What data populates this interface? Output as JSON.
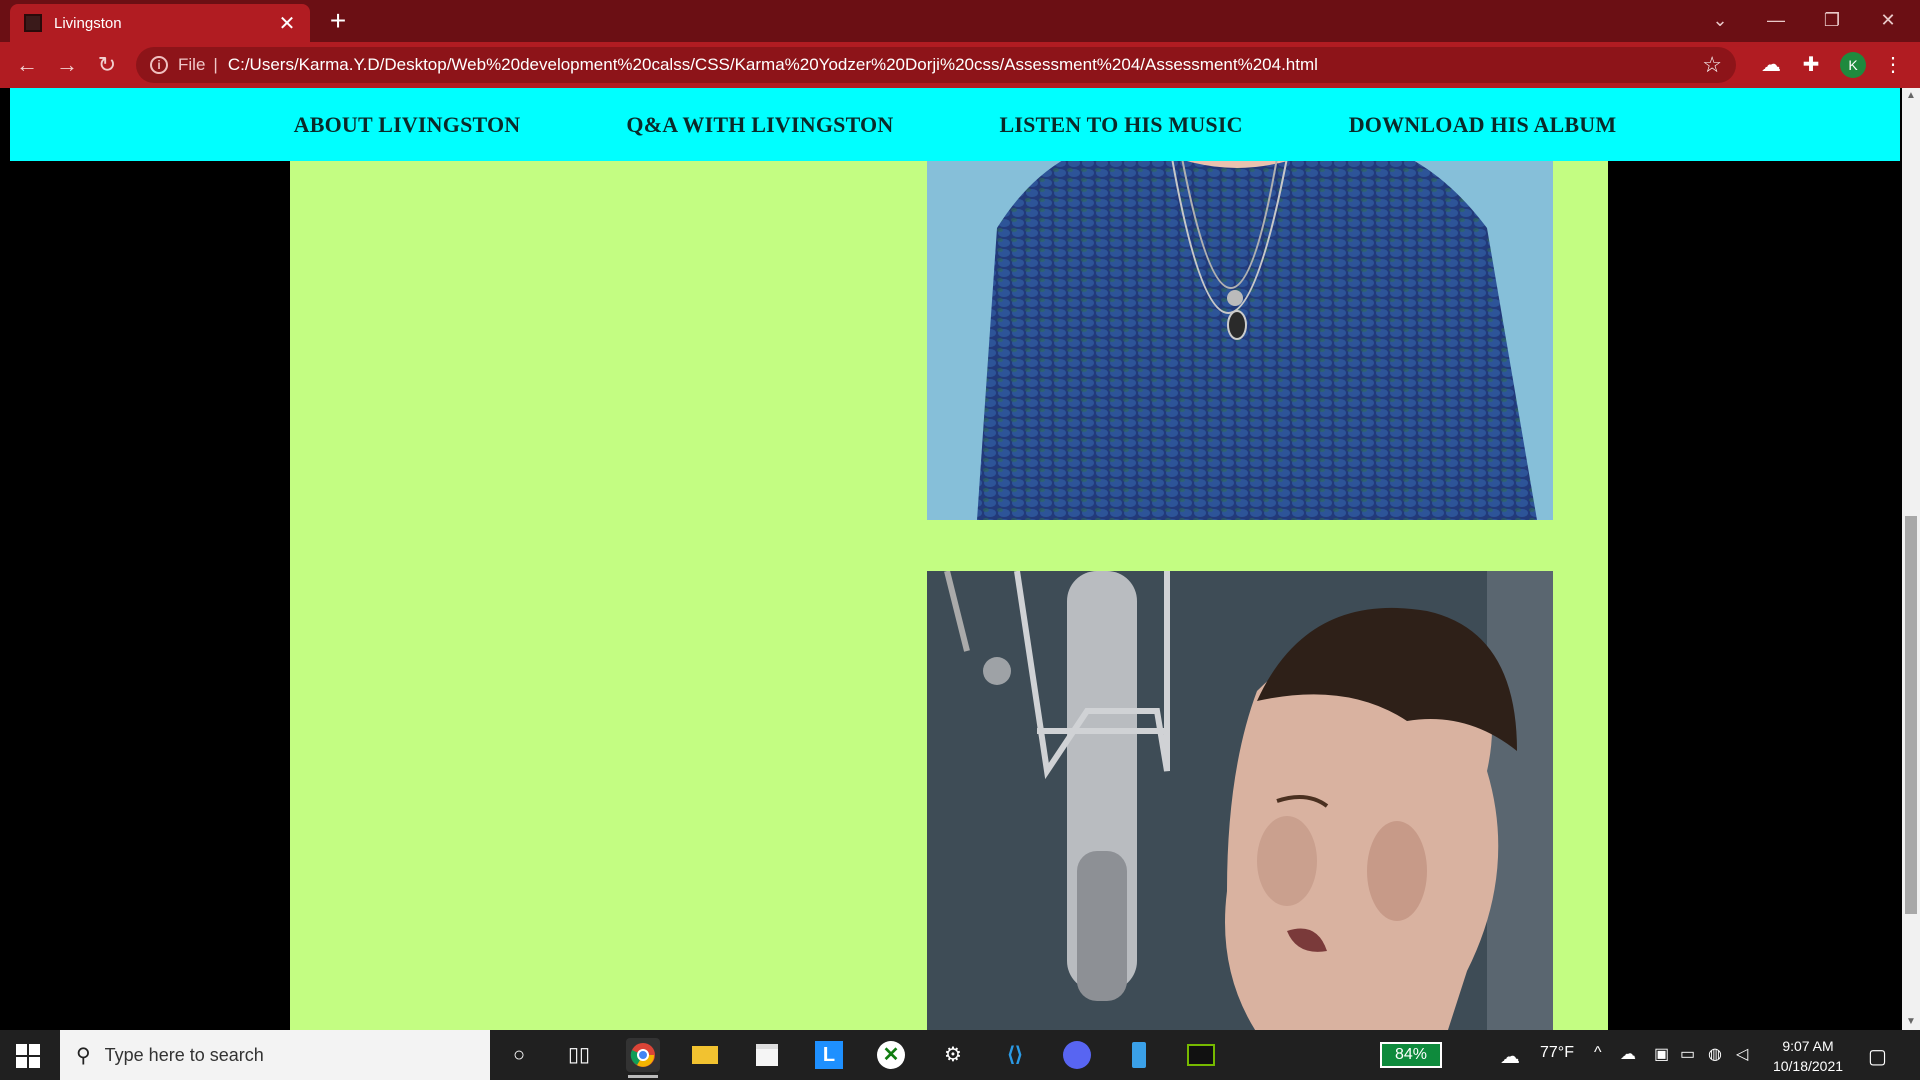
{
  "browser": {
    "tab_title": "Livingston",
    "tab_close": "✕",
    "new_tab": "+",
    "url_scheme": "File",
    "url_separator": "|",
    "url": "C:/Users/Karma.Y.D/Desktop/Web%20development%20calss/CSS/Karma%20Yodzer%20Dorji%20css/Assessment%204/Assessment%204.html",
    "profile_initial": "K",
    "icons": {
      "back": "back-arrow-icon",
      "forward": "forward-arrow-icon",
      "reload": "reload-icon",
      "info": "info-icon",
      "bookmark": "star-icon",
      "extensions": "puzzle-icon",
      "menu": "kebab-menu-icon"
    }
  },
  "page": {
    "nav": [
      "ABOUT LIVINGSTON",
      "Q&A WITH LIVINGSTON",
      "LISTEN TO HIS MUSIC",
      "DOWNLOAD HIS ALBUM"
    ],
    "colors": {
      "nav_bg": "#00ffff",
      "content_bg": "#c3fd82",
      "page_bg": "#000000"
    },
    "images": [
      "photo-man-sweater",
      "photo-man-microphone"
    ]
  },
  "taskbar": {
    "search_placeholder": "Type here to search",
    "battery": "84%",
    "weather": "77°F",
    "time": "9:07 AM",
    "date": "10/18/2021",
    "apps": [
      "chrome-icon",
      "file-explorer-icon",
      "store-icon",
      "l-app-icon",
      "xbox-icon",
      "steam-icon",
      "vscode-icon",
      "discord-icon",
      "phone-icon",
      "nvidia-icon"
    ]
  }
}
